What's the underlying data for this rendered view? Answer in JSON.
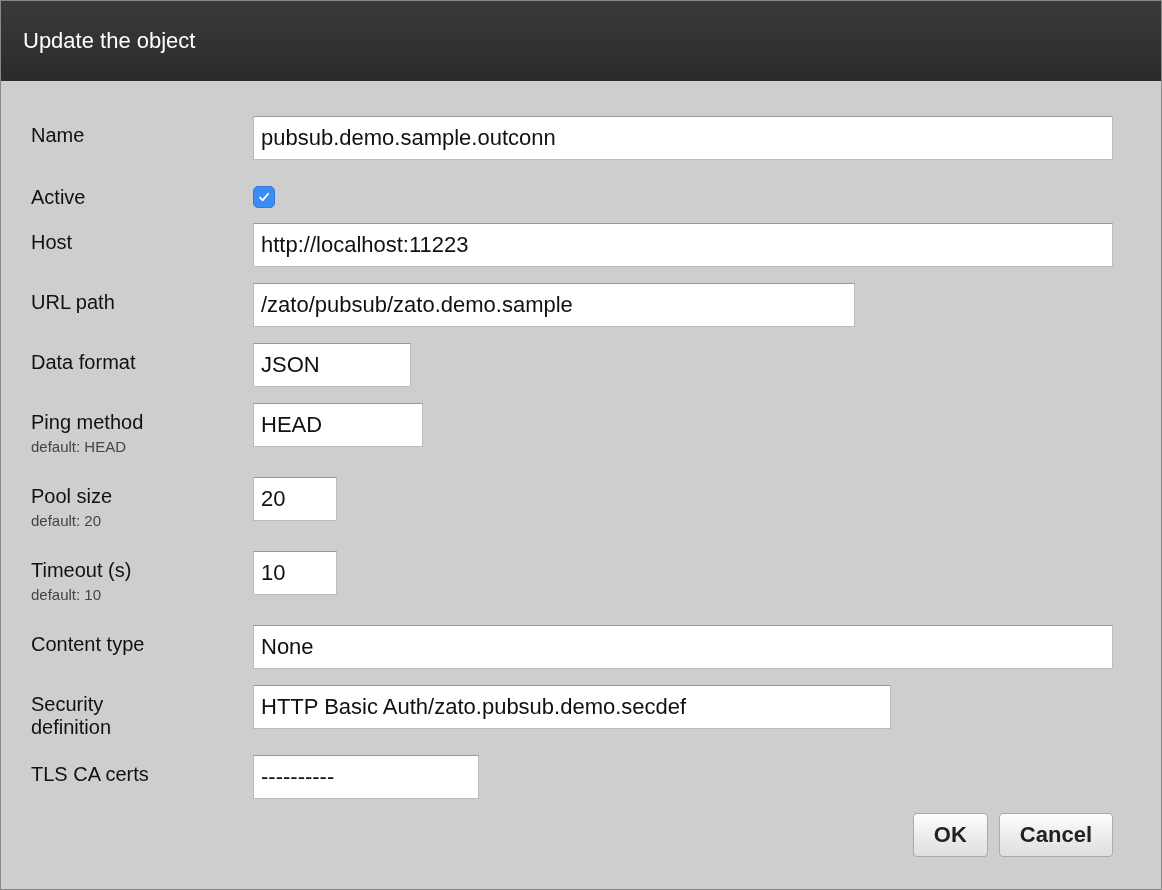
{
  "window": {
    "title": "Update the object"
  },
  "fields": [
    {
      "kind": "text",
      "label": "Name",
      "value": "pubsub.demo.sample.outconn"
    },
    {
      "kind": "checkbox",
      "label": "Active",
      "checked": true
    },
    {
      "kind": "text",
      "label": "Host",
      "value": "http://localhost:11223"
    },
    {
      "kind": "text",
      "label": "URL path",
      "value": "/zato/pubsub/zato.demo.sample"
    },
    {
      "kind": "text",
      "label": "Data format",
      "value": "JSON"
    },
    {
      "kind": "text",
      "label": "Ping method",
      "hint": "default: HEAD",
      "value": "HEAD"
    },
    {
      "kind": "text",
      "label": "Pool size",
      "hint": "default: 20",
      "value": "20"
    },
    {
      "kind": "text",
      "label": "Timeout (s)",
      "hint": "default: 10",
      "value": "10"
    },
    {
      "kind": "text",
      "label": "Content type",
      "value": "None"
    },
    {
      "kind": "text",
      "label": "Security definition",
      "value": "HTTP Basic Auth/zato.pubsub.demo.secdef"
    },
    {
      "kind": "text",
      "label": "TLS CA certs",
      "value": "----------"
    }
  ],
  "buttons": [
    "OK",
    "Cancel"
  ]
}
